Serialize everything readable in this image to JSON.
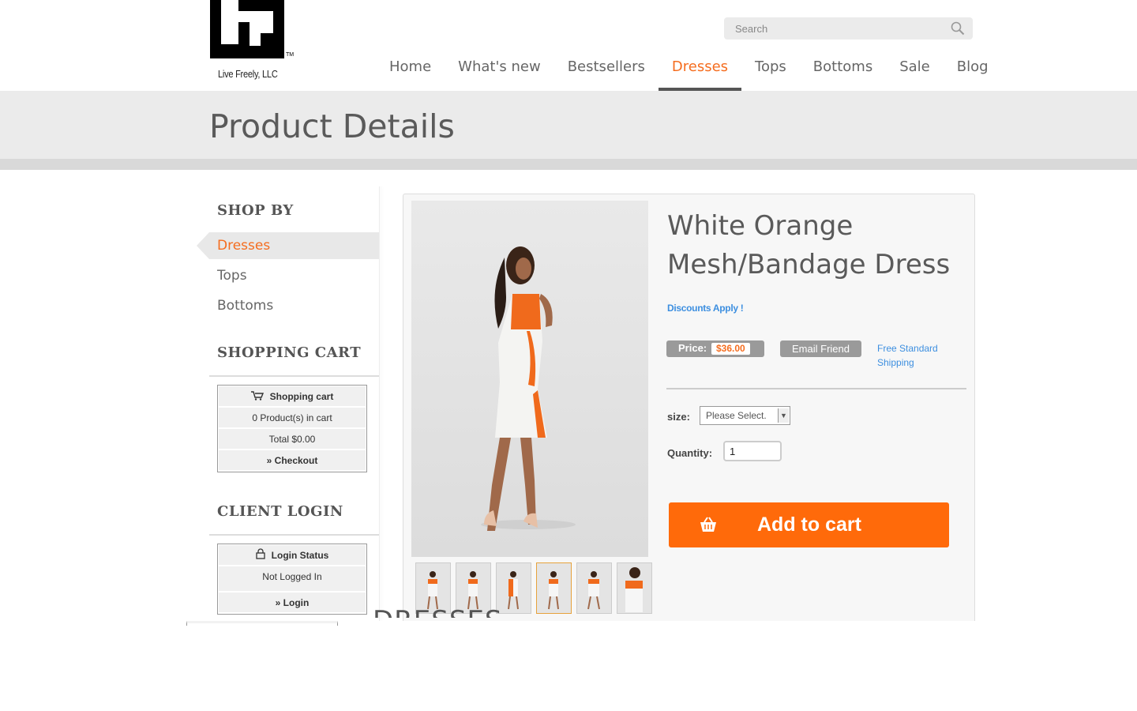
{
  "brand": {
    "logo_text": "Live Freely, LLC",
    "trademark": "TM"
  },
  "search": {
    "placeholder": "Search"
  },
  "nav": {
    "items": [
      "Home",
      "What's new",
      "Bestsellers",
      "Dresses",
      "Tops",
      "Bottoms",
      "Sale",
      "Blog"
    ],
    "active": "Dresses"
  },
  "page": {
    "title": "Product Details"
  },
  "sidebar": {
    "shop_by_heading": "SHOP BY",
    "categories": [
      "Dresses",
      "Tops",
      "Bottoms"
    ],
    "active_category": "Dresses",
    "cart_heading": "SHOPPING CART",
    "cart": {
      "title": "Shopping cart",
      "count": "0 Product(s) in cart",
      "total": "Total $0.00",
      "checkout": "» Checkout"
    },
    "login_heading": "CLIENT LOGIN",
    "login": {
      "title": "Login Status",
      "status": "Not Logged In",
      "action": "» Login"
    }
  },
  "product": {
    "title": "White Orange Mesh/Bandage Dress",
    "discounts": "Discounts Apply !",
    "price_label": "Price:",
    "price": "$36.00",
    "email_friend": "Email Friend",
    "shipping": "Free Standard Shipping",
    "size_label": "size:",
    "size_value": "Please Select.",
    "quantity_label": "Quantity:",
    "quantity_value": "1",
    "add_to_cart": "Add to cart",
    "thumbnail_count": 6,
    "active_thumbnail": 4
  },
  "colors": {
    "accent": "#f56d1f",
    "button": "#ff6a0a",
    "link": "#3d8fe0"
  },
  "footer_partial": {
    "heading": "DRESSES"
  }
}
